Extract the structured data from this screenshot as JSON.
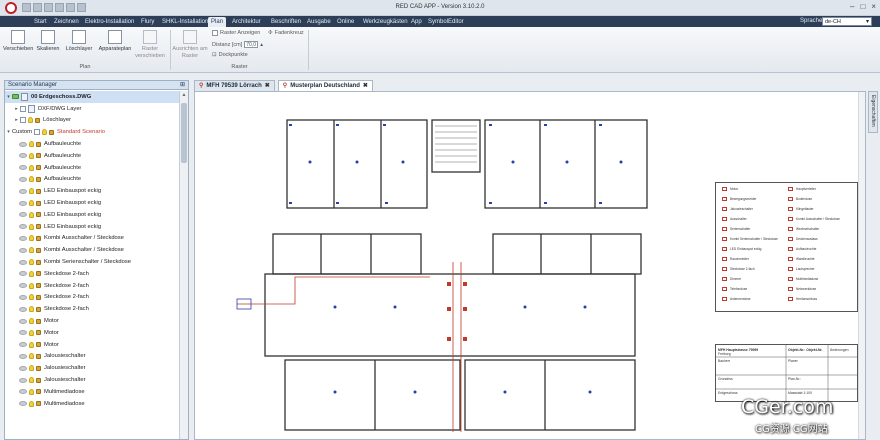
{
  "window": {
    "title": "RED CAD APP - Version 3.10.2.0"
  },
  "menu": {
    "items": [
      "Start",
      "Zeichnen",
      "Elektro-Installation",
      "Flury",
      "SHKL-Installation",
      "Plan",
      "Architektur",
      "Beschriften",
      "Ausgabe",
      "Online",
      "Werkzeugkästen",
      "App",
      "SymbolEditor"
    ],
    "active": "Plan",
    "language_label": "Sprache",
    "language_value": "de-CH"
  },
  "ribbon": {
    "plan_buttons": [
      "Verschieben",
      "Skalieren",
      "Löschlayer",
      "Apparateplan",
      "Raster verschieben",
      "Ausrichten am Raster"
    ],
    "group_plan": "Plan",
    "group_raster": "Raster",
    "raster_show": "Raster Anzeigen",
    "crosshair": "Fadenkreuz",
    "distance_label": "Distanz [cm]",
    "distance_value": "70,0",
    "dockpoints": "Dockpunkte"
  },
  "scenario_manager": {
    "title": "Scenario Manager",
    "root": "00 Erdgeschoss.DWG",
    "dxf_layer": "DXF/DWG Layer",
    "loeschlayer": "Löschlayer",
    "custom": "Custom",
    "standard": "Standard Scenario",
    "items": [
      "Aufbauleuchte",
      "Aufbauleuchte",
      "Aufbauleuchte",
      "Aufbauleuchte",
      "LED Einbauspot eckig",
      "LED Einbauspot eckig",
      "LED Einbauspot eckig",
      "LED Einbauspot eckig",
      "Kombi Ausschalter / Steckdose",
      "Kombi Ausschalter / Steckdose",
      "Kombi Serienschalter / Steckdose",
      "Steckdose 2-fach",
      "Steckdose 2-fach",
      "Steckdose 2-fach",
      "Steckdose 2-fach",
      "Motor",
      "Motor",
      "Motor",
      "Jalousieschalter",
      "Jalousieschalter",
      "Jalousieschalter",
      "Multimediadose",
      "Multimediadose"
    ]
  },
  "tabs": [
    {
      "label": "MFH 79539 Lörrach",
      "active": false
    },
    {
      "label": "Musterplan Deutschland",
      "active": true
    }
  ],
  "side_tab": "Eigenschaften",
  "watermark": {
    "main": "CGer.com",
    "sub": "CG资源 CG网站"
  },
  "colors": {
    "menubar": "#2d3f58",
    "accent_red": "#c0392b",
    "wall": "#333333",
    "symbol_blue": "#2a3ea8"
  }
}
